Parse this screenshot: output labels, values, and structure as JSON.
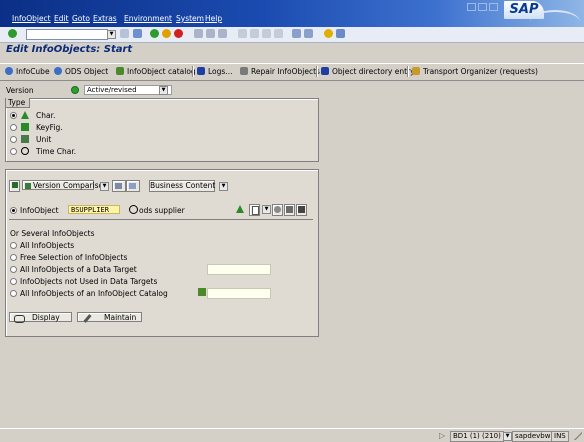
{
  "menubar": {
    "items": [
      "InfoObject",
      "Edit",
      "Goto",
      "Extras",
      "Environment",
      "System",
      "Help"
    ],
    "logo": "SAP"
  },
  "title": "Edit InfoObjects: Start",
  "app_toolbar": {
    "buttons": [
      "InfoCube",
      "ODS Object",
      "InfoObject catalog",
      "Logs...",
      "Repair InfoObjects",
      "Object directory entry",
      "Transport Organizer (requests)"
    ]
  },
  "version": {
    "label": "Version",
    "value": "Active/revised"
  },
  "type_group": {
    "title": "Type",
    "options": [
      "Char.",
      "KeyFig.",
      "Unit",
      "Time Char."
    ],
    "selected": "Char."
  },
  "main_group": {
    "version_comparison": "Version Comparison",
    "business_content": "Business Content",
    "infoobject_label": "InfoObject",
    "infoobject_value": "BSUPPLIER",
    "infoobject_desc": "ods supplier",
    "several_label": "Or Several InfoObjects",
    "several_options": [
      "All InfoObjects",
      "Free Selection of InfoObjects",
      "All InfoObjects of a Data Target",
      "InfoObjects not Used in Data Targets",
      "All InfoObjects of an InfoObject Catalog"
    ],
    "display_label": "Display",
    "maintain_label": "Maintain"
  },
  "statusbar": {
    "system": "BD1 (1) (210)",
    "server": "sapdevbw",
    "mode": "INS"
  },
  "colors": {
    "menubar": "#1b4bb0",
    "title": "#0a2a78",
    "status_green": "#2ca02c"
  }
}
